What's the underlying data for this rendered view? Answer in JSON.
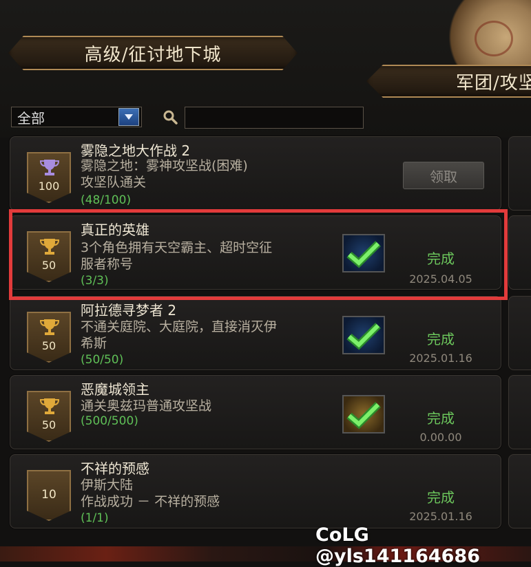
{
  "tabs": {
    "left": "高级/征讨地下城",
    "right": "军团/攻坚"
  },
  "filter": {
    "selected": "全部",
    "search_value": ""
  },
  "achievements": [
    {
      "title": "雾隐之地大作战 2",
      "desc": "雾隐之地：雾神攻坚战(困难)\n攻坚队通关",
      "progress": "(48/100)",
      "points": "100",
      "trophy": "purple",
      "action": "领取",
      "status": "",
      "date": ""
    },
    {
      "title": "真正的英雄",
      "desc": "3个角色拥有天空霸主、超时空征\n服者称号",
      "progress": "(3/3)",
      "points": "50",
      "trophy": "gold",
      "status": "完成",
      "date": "2025.04.05",
      "icon": "blue"
    },
    {
      "title": "阿拉德寻梦者 2",
      "desc": "不通关庭院、大庭院，直接消灭伊\n希斯",
      "progress": "(50/50)",
      "points": "50",
      "trophy": "gold",
      "status": "完成",
      "date": "2025.01.16",
      "icon": "blue"
    },
    {
      "title": "恶魔城领主",
      "desc": "通关奥兹玛普通攻坚战",
      "progress": "(500/500)",
      "points": "50",
      "trophy": "gold",
      "status": "完成",
      "date": "0.00.00",
      "icon": "gold"
    },
    {
      "title": "不祥的预感",
      "desc": "伊斯大陆\n作战成功 － 不祥的预感",
      "progress": "(1/1)",
      "points": "10",
      "trophy": "none",
      "status": "完成",
      "date": "2025.01.16",
      "icon": "none"
    }
  ],
  "watermark": "CoLG @yls141164686",
  "colors": {
    "accent_green": "#6cc65c",
    "highlight_red": "#e23b3b",
    "gold": "#b08a55"
  },
  "icons": [
    "search-icon",
    "chevron-down-icon",
    "trophy-icon",
    "checkmark-icon"
  ]
}
